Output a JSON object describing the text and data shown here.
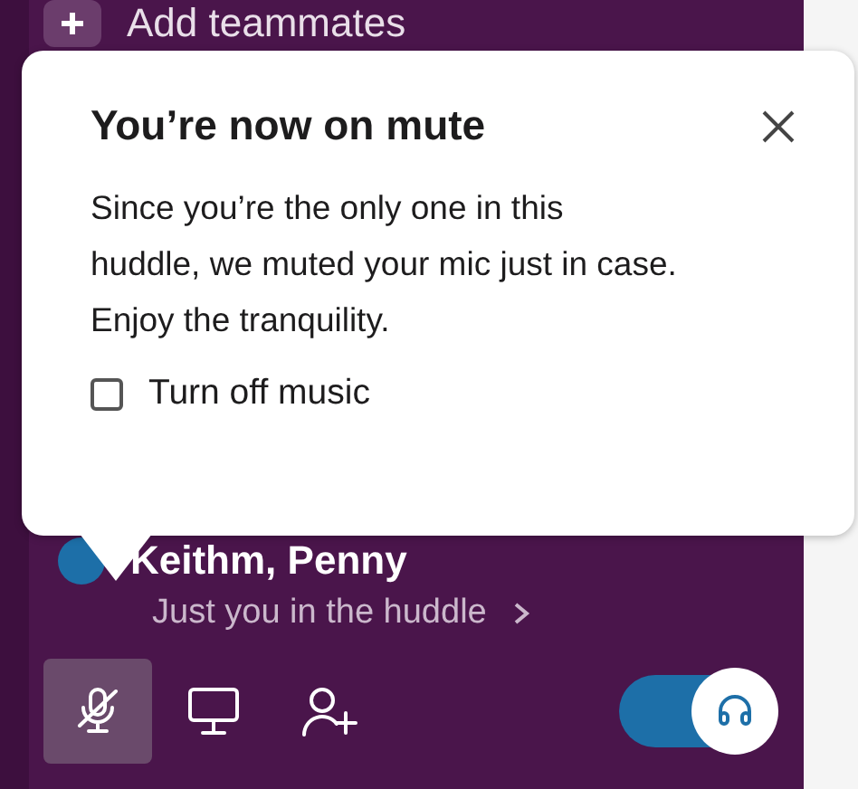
{
  "sidebar": {
    "add_item": {
      "label": "Add teammates"
    }
  },
  "huddle": {
    "title": "Keithm, Penny",
    "subtitle": "Just you in the huddle"
  },
  "toolbar": [
    {
      "kind": "mute",
      "selected": true
    },
    {
      "kind": "screen",
      "selected": false
    },
    {
      "kind": "invite",
      "selected": false
    }
  ],
  "music_toggle": {
    "on": true
  },
  "popover": {
    "title": "You’re now on mute",
    "body": "Since you’re the only one in this huddle, we muted your mic just in case. Enjoy the tranquility.",
    "checkbox": {
      "label": "Turn off music",
      "checked": false
    }
  }
}
